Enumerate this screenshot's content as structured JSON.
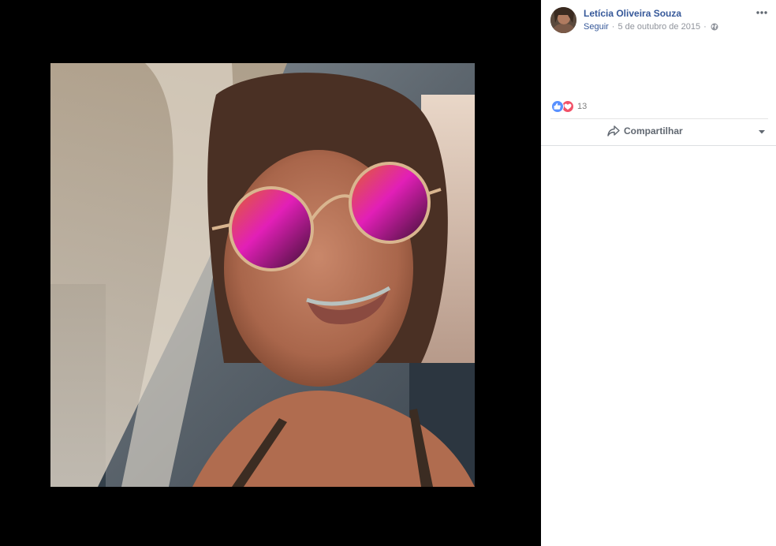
{
  "post": {
    "author": "Letícia Oliveira Souza",
    "follow_label": "Seguir",
    "date": "5 de outubro de 2015",
    "separator": "·",
    "privacy_icon": "globe-icon",
    "more_icon": "more-options-icon"
  },
  "reactions": {
    "types": [
      "like",
      "love"
    ],
    "count": "13",
    "colors": {
      "like": "#5890ff",
      "love": "#f25268"
    }
  },
  "actions": {
    "share_label": "Compartilhar",
    "share_icon": "share-arrow-icon",
    "dropdown_icon": "caret-down-icon"
  },
  "theme": {
    "link_color": "#365899",
    "muted_color": "#90949c",
    "viewer_bg": "#000000"
  }
}
